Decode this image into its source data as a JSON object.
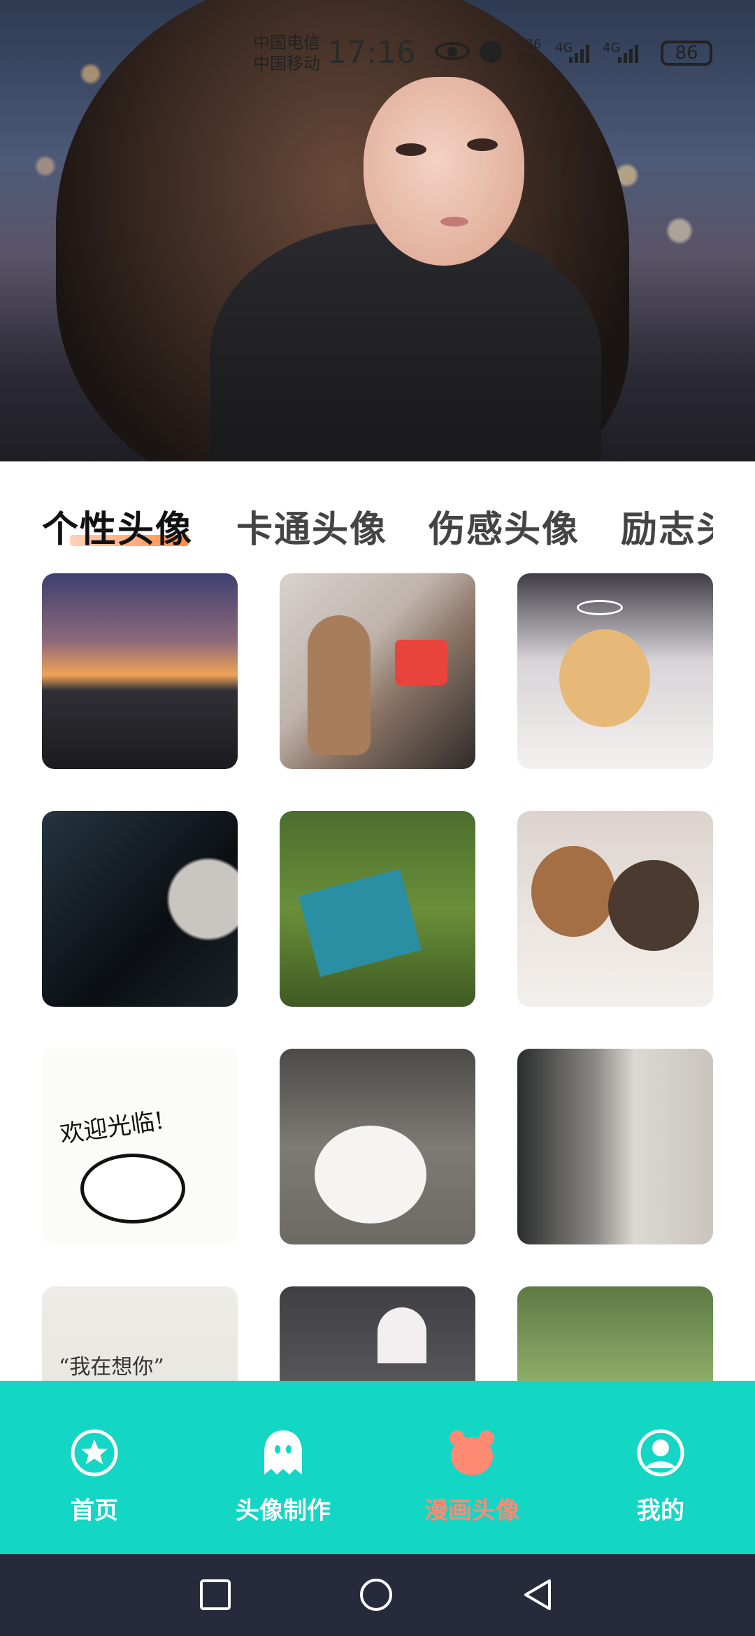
{
  "status_bar": {
    "carrier_1": "中国电信",
    "carrier_2": "中国移动",
    "time": "17:16",
    "net_speed_value": "336",
    "net_speed_unit": "B/s",
    "signal_1": "4G",
    "signal_2": "4G",
    "battery": "86"
  },
  "tabs": [
    {
      "label": "个性头像",
      "active": true
    },
    {
      "label": "卡通头像",
      "active": false
    },
    {
      "label": "伤感头像",
      "active": false
    },
    {
      "label": "励志头像",
      "active": false
    }
  ],
  "grid": {
    "tile_6_text": "欢迎光临!",
    "tile_9_text": "“我在想你”"
  },
  "bottom_nav": [
    {
      "label": "首页",
      "icon": "star-icon",
      "active": false
    },
    {
      "label": "头像制作",
      "icon": "ghost-icon",
      "active": false
    },
    {
      "label": "漫画头像",
      "icon": "bear-icon",
      "active": true
    },
    {
      "label": "我的",
      "icon": "person-icon",
      "active": false
    }
  ],
  "colors": {
    "nav_bg": "#14d6c4",
    "nav_active": "#ff8a73",
    "tab_underline": "#ff8c4a",
    "system_nav_bg": "#262a3a"
  }
}
